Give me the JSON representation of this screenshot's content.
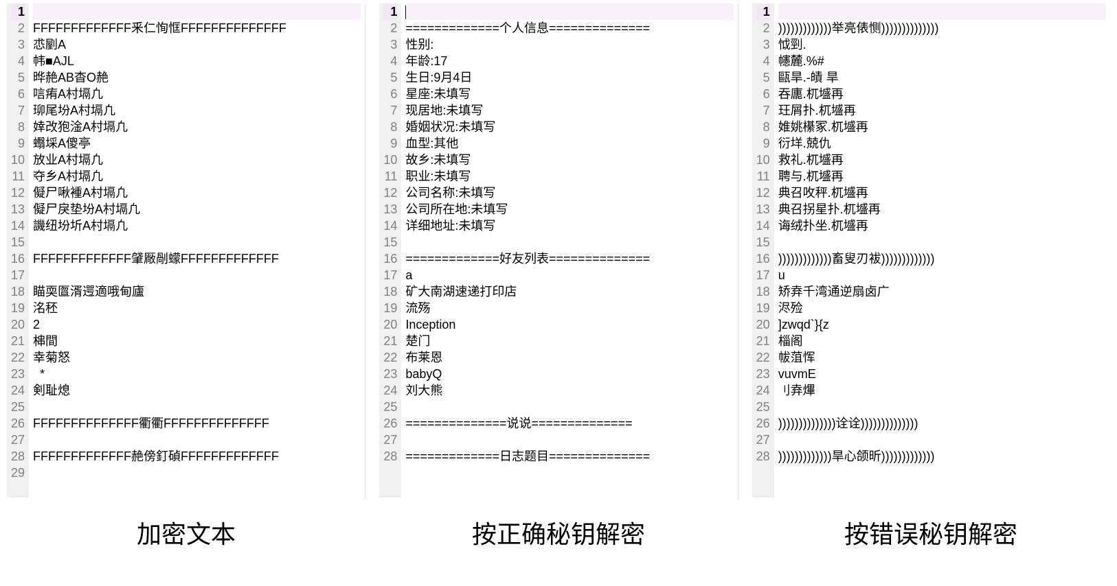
{
  "panels": [
    {
      "label": "加密文本",
      "lines": [
        "",
        "FFFFFFFFFFFFF釆仁恂恇FFFFFFFFFFFFFF",
        "怷剭A",
        "帏■AJL",
        "晔赩AB杳O赩",
        "唁痏A村塥凢",
        "珋尾坋A村塥凢",
        "婞改狍淦A村塥凢",
        "蠮埰A傻亭",
        "放业A村塥凢",
        "夺乡A村塥凢",
        "儗尸啾褈A村塥凢",
        "儗尸戾垫坋A村塥凢",
        "譏纽坋圻A村塥凢",
        "",
        "FFFFFFFFFFFFF肈厰剮蠓FFFFFFFFFFFFF",
        "",
        "瞄耎匫湑遌適哦甸廬",
        "洺秠",
        "2",
        "梙間",
        "幸菊怒",
        "  *",
        "剣耻熄",
        "",
        "FFFFFFFFFFFFFF衢衢FFFFFFFFFFFFFF",
        "",
        "FFFFFFFFFFFFF赩傍釘碵FFFFFFFFFFFFF",
        ""
      ],
      "max_line": 29
    },
    {
      "label": "按正确秘钥解密",
      "lines": [
        "",
        "=============个人信息==============",
        "性别:",
        "年龄:17",
        "生日:9月4日",
        "星座:未填写",
        "现居地:未填写",
        "婚姻状况:未填写",
        "血型:其他",
        "故乡:未填写",
        "职业:未填写",
        "公司名称:未填写",
        "公司所在地:未填写",
        "详细地址:未填写",
        "",
        "=============好友列表==============",
        "a",
        "矿大南湖速递打印店",
        "流殇",
        "Inception",
        "楚门",
        "布莱恩",
        "babyQ",
        "刘大熊",
        "",
        "==============说说==============",
        "",
        "=============日志题目=============="
      ],
      "max_line": 28,
      "show_cursor": true
    },
    {
      "label": "按错误秘钥解密",
      "lines": [
        "",
        ")))))))))))))举亮俵恻))))))))))))))",
        "怴剄.",
        "幰麓.%#",
        "甌旱.-皟 旱",
        "吞廤.杌墭再",
        "玨屑扑.杌墭再",
        "婎姚櫀冢.杌墭再",
        "衍垟.兢仇",
        "救礼.杌墭再",
        "聘与.杌墭再",
        "典召呚秤.杌墭再",
        "典召拐星扑.杌墭再",
        "诲绒扑坐.杌墭再",
        "",
        ")))))))))))))畜叟刃袚)))))))))))))",
        "u",
        "矫弆千湾通逆扇卤广",
        "浕殓",
        "]zwqd`}{z",
        "椔阁",
        "帗菹恽",
        "vuvmE",
        "刂弆熚",
        "",
        "))))))))))))))诠诠))))))))))))))",
        "",
        ")))))))))))))旱心颌昕)))))))))))))"
      ],
      "max_line": 28
    }
  ]
}
